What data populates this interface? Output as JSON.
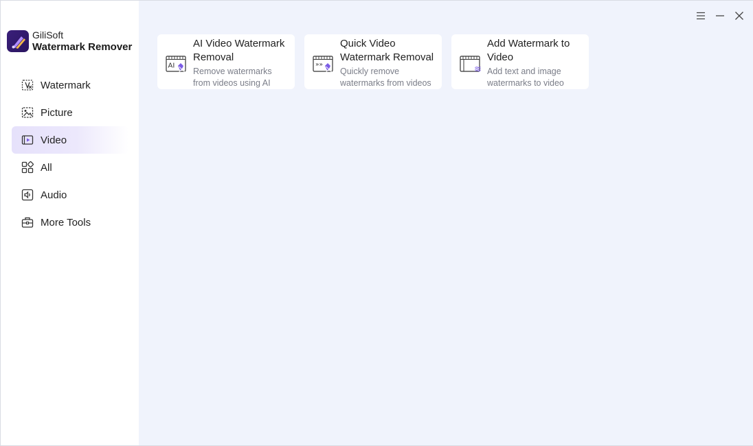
{
  "brand": {
    "company": "GiliSoft",
    "product": "Watermark Remover",
    "accent": "#7b5ce6"
  },
  "sidebar": {
    "items": [
      {
        "label": "Watermark",
        "icon": "watermark-icon"
      },
      {
        "label": "Picture",
        "icon": "picture-icon"
      },
      {
        "label": "Video",
        "icon": "video-icon",
        "active": true
      },
      {
        "label": "All",
        "icon": "all-grid-icon"
      },
      {
        "label": "Audio",
        "icon": "audio-icon"
      },
      {
        "label": "More Tools",
        "icon": "toolbox-icon"
      }
    ]
  },
  "window_controls": [
    "menu-icon",
    "minimize-icon",
    "close-icon"
  ],
  "cards": [
    {
      "title_line1": "AI Video Watermark",
      "title_line2": "Removal",
      "desc_line1": "Remove watermarks",
      "desc_line2": "from videos using AI",
      "icon": "ai-video-watermark-icon",
      "icon_text": "AI"
    },
    {
      "title_line1": "Quick Video",
      "title_line2": "Watermark Removal",
      "desc_line1": "Quickly remove",
      "desc_line2": "watermarks from videos",
      "icon": "quick-video-watermark-icon",
      "icon_text": "»»"
    },
    {
      "title_line1": "Add Watermark to",
      "title_line2": "Video",
      "desc_line1": "Add text and image",
      "desc_line2": "watermarks to video",
      "icon": "add-watermark-video-icon",
      "icon_text": "≋"
    }
  ]
}
